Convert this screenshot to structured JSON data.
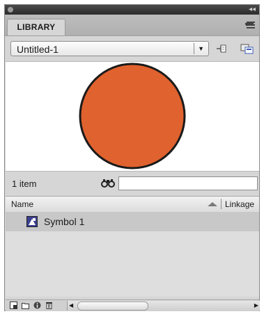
{
  "panel": {
    "tab_label": "LIBRARY",
    "icons": [
      "panel-menu-icon",
      "pin-library-icon",
      "new-library-panel-icon"
    ]
  },
  "document": {
    "selected": "Untitled-1"
  },
  "preview": {
    "shape": "circle",
    "fill": "#E0622E",
    "stroke": "#1a1a1a"
  },
  "list": {
    "count": "1 item",
    "search_value": "",
    "columns": {
      "name": "Name",
      "linkage": "Linkage"
    },
    "items": [
      {
        "label": "Symbol 1",
        "icon": "graphic-symbol-icon"
      }
    ]
  },
  "bottom_toolbar": {
    "icons": [
      "new-symbol-icon",
      "new-folder-icon",
      "properties-icon",
      "delete-icon"
    ]
  }
}
